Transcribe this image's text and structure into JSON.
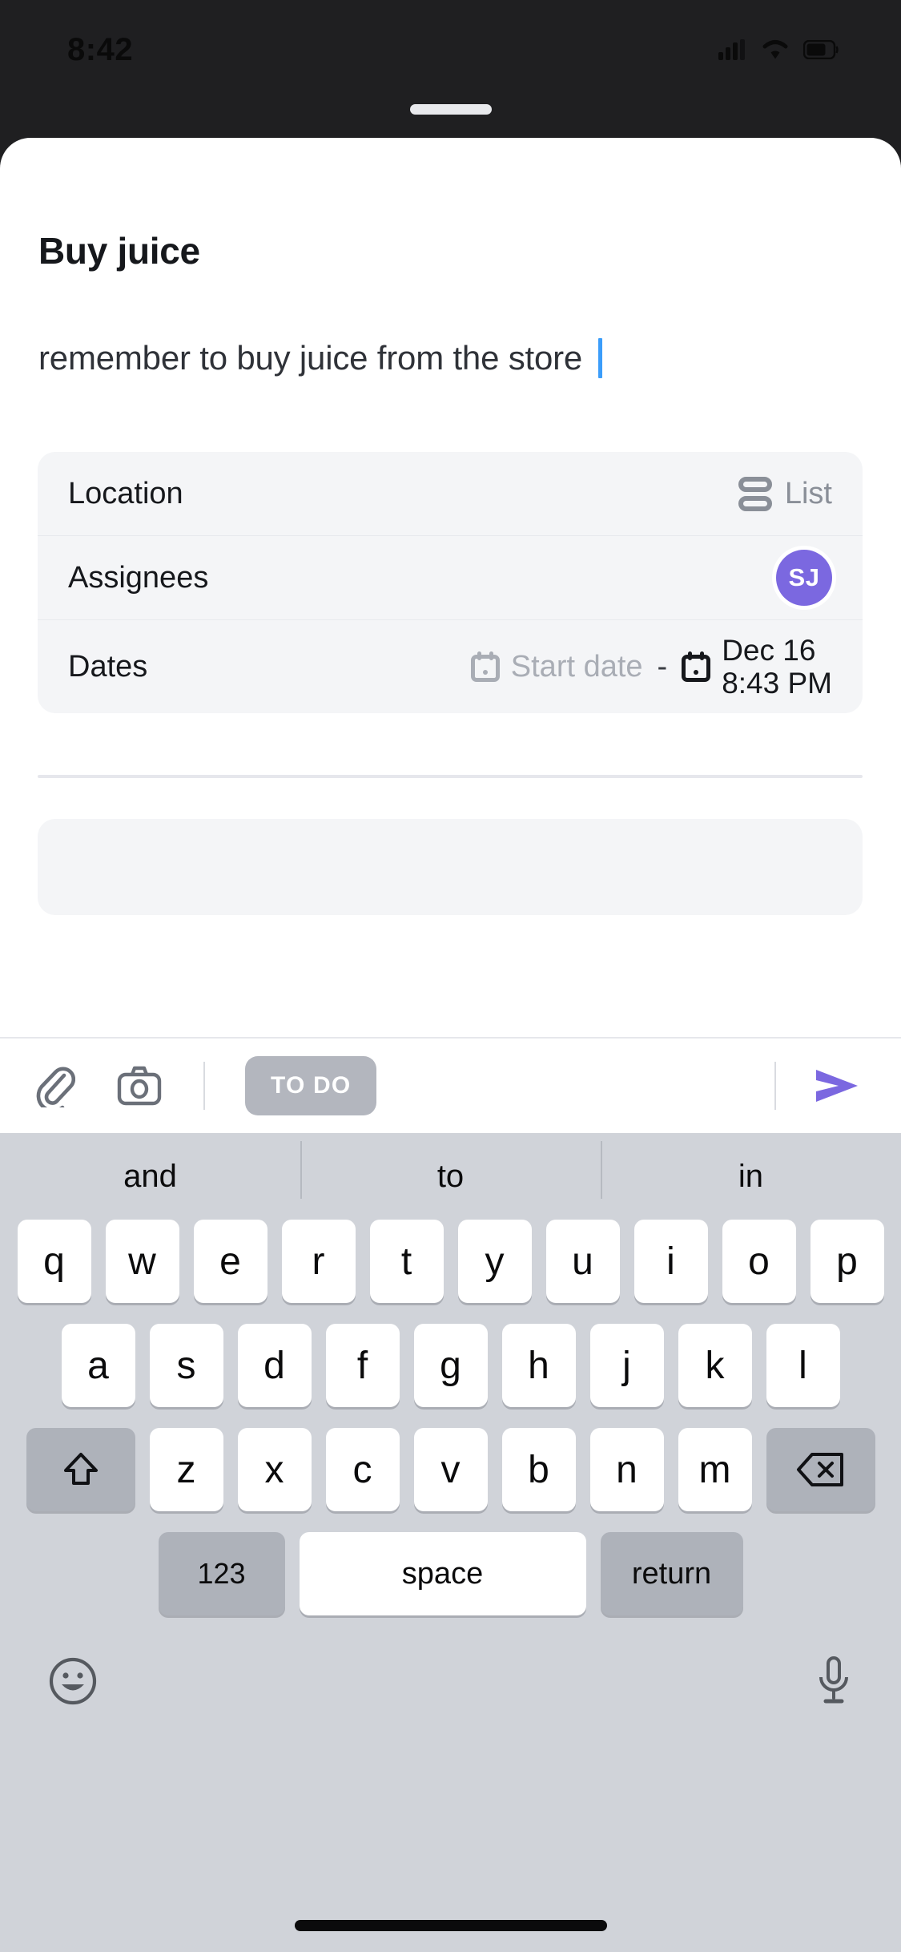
{
  "status_bar": {
    "time": "8:42",
    "icons": [
      "cellular-signal-icon",
      "wifi-icon",
      "battery-icon"
    ]
  },
  "sheet": {
    "grabber": "drag-handle",
    "task_title": "Buy juice",
    "task_description": "remember to buy juice from the store",
    "properties": [
      {
        "label": "Location",
        "value": "List",
        "icon": "list-icon"
      },
      {
        "label": "Assignees",
        "value": "SJ",
        "icon": "avatar",
        "avatar_color": "#7b68e0"
      },
      {
        "label": "Dates",
        "start_placeholder": "Start date",
        "separator": "-",
        "due_date": "Dec 16",
        "due_time": "8:43 PM",
        "start_icon": "calendar-icon",
        "due_icon": "calendar-icon"
      }
    ]
  },
  "toolbar": {
    "attach_icon": "paperclip-icon",
    "camera_icon": "camera-icon",
    "status_label": "TO DO",
    "status_color": "#b3b6be",
    "send_icon": "send-arrow-icon",
    "send_color": "#7b68e0"
  },
  "keyboard": {
    "suggestions": [
      "and",
      "to",
      "in"
    ],
    "row1": [
      "q",
      "w",
      "e",
      "r",
      "t",
      "y",
      "u",
      "i",
      "o",
      "p"
    ],
    "row2": [
      "a",
      "s",
      "d",
      "f",
      "g",
      "h",
      "j",
      "k",
      "l"
    ],
    "row3": [
      "z",
      "x",
      "c",
      "v",
      "b",
      "n",
      "m"
    ],
    "shift_icon": "shift-icon",
    "backspace_icon": "backspace-icon",
    "numbers_label": "123",
    "space_label": "space",
    "return_label": "return",
    "emoji_icon": "emoji-icon",
    "mic_icon": "microphone-icon"
  }
}
